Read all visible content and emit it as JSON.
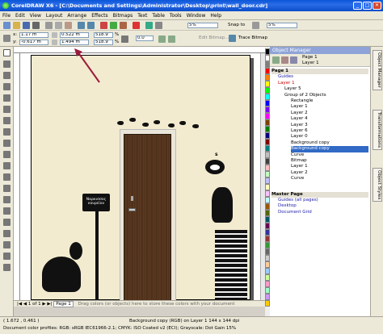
{
  "window": {
    "title": "CorelDRAW X6 - [C:\\Documents and Settings\\Administrator\\Desktop\\print\\wall_door.cdr]",
    "minimize": "_",
    "maximize": "□",
    "close": "✕"
  },
  "menu": [
    "File",
    "Edit",
    "View",
    "Layout",
    "Arrange",
    "Effects",
    "Bitmaps",
    "Text",
    "Table",
    "Tools",
    "Window",
    "Help"
  ],
  "toolbar1": {
    "zoom": "5%",
    "snap_to": "Snap to",
    "launch": "5%"
  },
  "toolbar2": {
    "x": "1.17 m",
    "y": "-0.617 m",
    "width": "0.522 m",
    "height": "1.494 m",
    "scale_w": "518.9",
    "scale_h": "518.9",
    "pct": "%",
    "edit_bitmap": "Edit Bitmap...",
    "trace_bitmap": "Trace Bitmap",
    "angle": "0.0"
  },
  "canvas": {
    "sign_text": "Ναρκισσος κουρεϊον",
    "cat_mark": "s"
  },
  "docbar": {
    "page_counter": "1 of 1",
    "page_tab": "Page 1",
    "hint": "Drag colors (or objects) here to store these colors with your document"
  },
  "status": {
    "coords": "( 1.672 , 0.461 )",
    "profiles": "Document color profiles: RGB: sRGB IEC61966-2.1; CMYK: ISO Coated v2 (ECI); Grayscale: Dot Gain 15%",
    "object_info": "Background copy (RGB) on Layer 1 144 x 144 dpi"
  },
  "docker": {
    "title": "Object Manager",
    "toolbar_page": "Page 1",
    "toolbar_layer": "Layer 1",
    "rows": [
      "Page 1",
      "Guides",
      "Layer 1",
      "Layer 5",
      "Group of 2 Objects",
      "Rectangle",
      "Layer 1",
      "Layer 2",
      "Layer 4",
      "Layer 3",
      "Layer 6",
      "Layer 0",
      "Background copy",
      "Background copy",
      "Curve",
      "Bitmap",
      "Layer 1",
      "Layer 2",
      "Curve",
      "Master Page",
      "Guides (all pages)",
      "Desktop",
      "Document Grid"
    ]
  },
  "side_tabs": [
    "Object Manager",
    "Transformations",
    "Object Styles"
  ],
  "colors": {
    "accent": "#316ac5",
    "page": "#f3ebcf",
    "door": "#5b3a22",
    "title_bar": "#0a56d8"
  },
  "palette": [
    "#000000",
    "#ffffff",
    "#7f7f7f",
    "#ff0000",
    "#ff7f00",
    "#ffff00",
    "#00ff00",
    "#00ffff",
    "#0000ff",
    "#7f00ff",
    "#ff00ff",
    "#7f3f00",
    "#007f00",
    "#00007f",
    "#7f0000",
    "#007f7f",
    "#bfbfbf",
    "#3f3f3f",
    "#ffbfbf",
    "#bfffbf",
    "#bfbfff",
    "#ffffbf",
    "#ffbfff",
    "#bfffff",
    "#995500",
    "#556600",
    "#005566",
    "#660055",
    "#333399",
    "#993333",
    "#339933",
    "#666666",
    "#cccccc",
    "#ffcc99",
    "#99ccff",
    "#ccff99",
    "#ff99cc",
    "#99ffcc",
    "#cc99ff",
    "#ffcc00"
  ]
}
